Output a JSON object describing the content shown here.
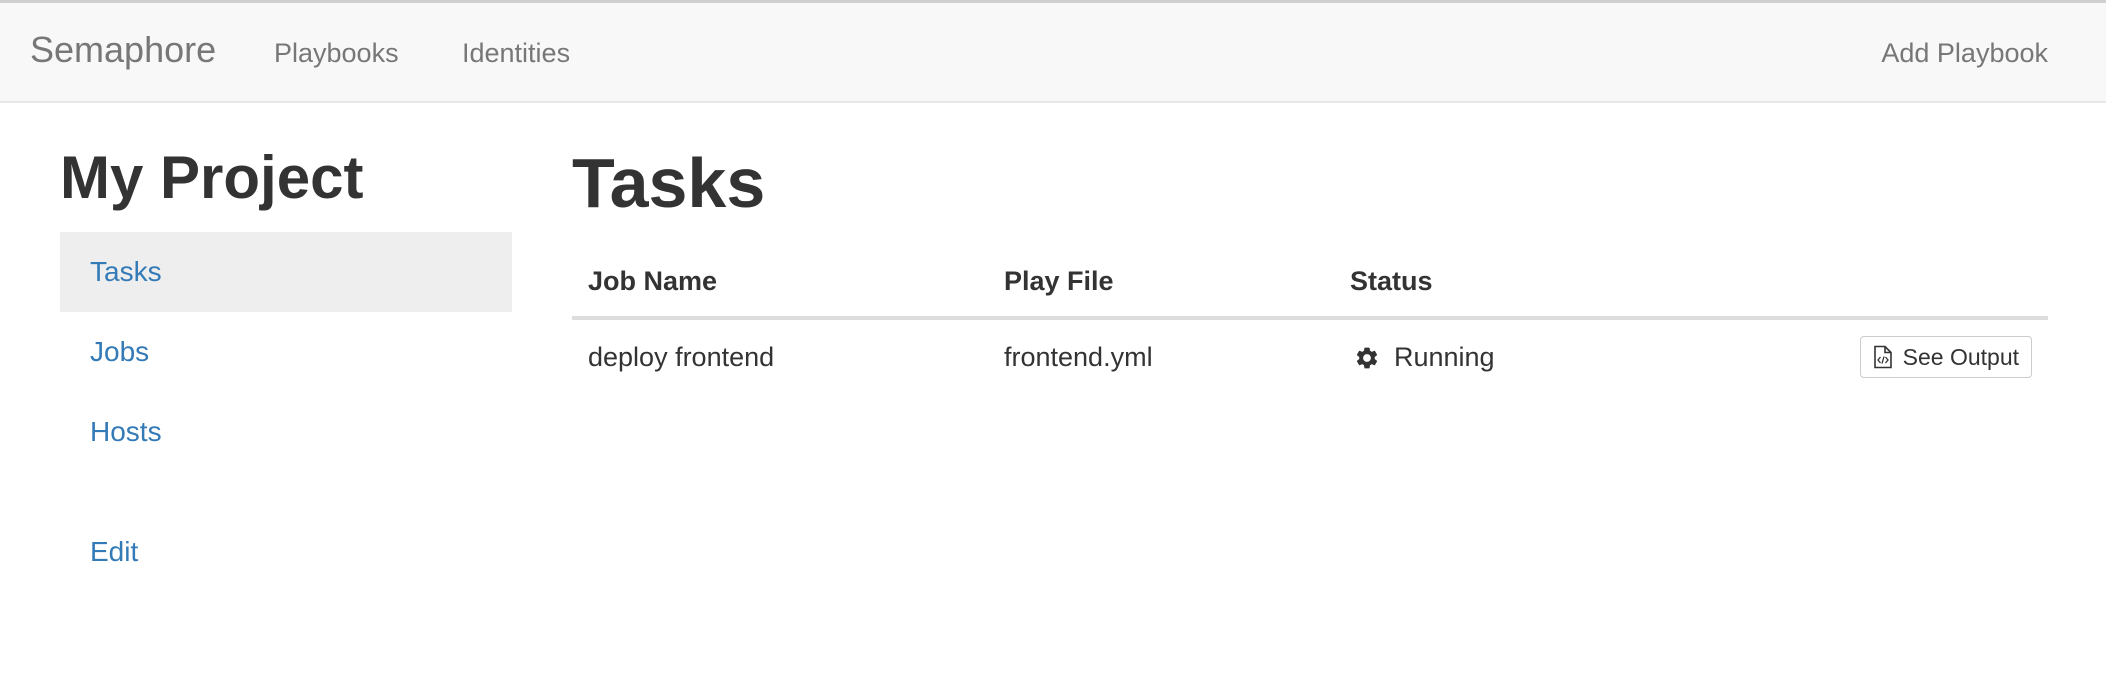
{
  "navbar": {
    "brand": "Semaphore",
    "links": [
      "Playbooks",
      "Identities"
    ],
    "right_link": "Add Playbook"
  },
  "sidebar": {
    "project_title": "My Project",
    "items": [
      {
        "label": "Tasks",
        "active": true
      },
      {
        "label": "Jobs",
        "active": false
      },
      {
        "label": "Hosts",
        "active": false
      },
      {
        "label": "Edit",
        "active": false
      }
    ]
  },
  "main": {
    "title": "Tasks",
    "table": {
      "headers": [
        "Job Name",
        "Play File",
        "Status"
      ],
      "rows": [
        {
          "job_name": "deploy frontend",
          "play_file": "frontend.yml",
          "status": "Running",
          "status_icon": "gear-icon",
          "action_label": "See Output",
          "action_icon": "file-code-icon"
        }
      ]
    }
  },
  "colors": {
    "link": "#337ab7",
    "navbar_bg": "#f8f8f8",
    "active_bg": "#eeeeee",
    "text": "#333333",
    "muted": "#777777"
  }
}
